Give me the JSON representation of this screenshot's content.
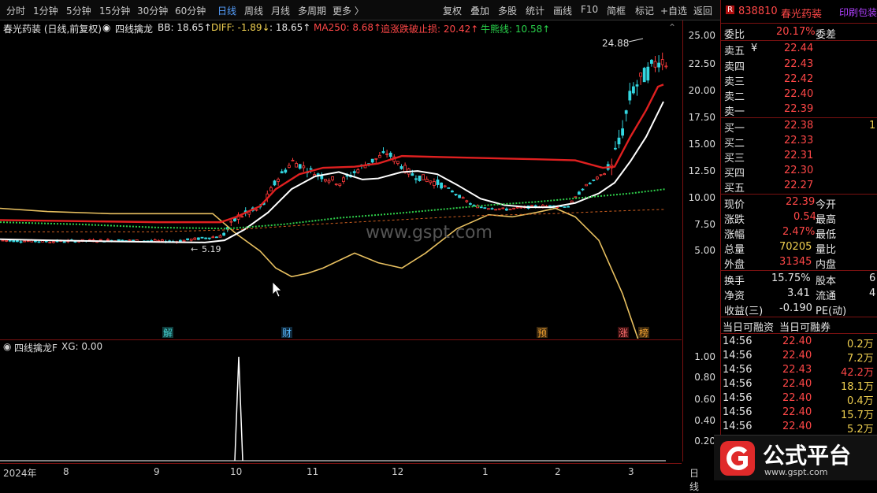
{
  "toolbar": {
    "periods": [
      "分时",
      "1分钟",
      "5分钟",
      "15分钟",
      "30分钟",
      "60分钟",
      "日线",
      "周线",
      "月线",
      "多周期",
      "更多 〉"
    ],
    "active_period": "日线",
    "tools": [
      "复权",
      "叠加",
      "多股",
      "统计",
      "画线",
      "F10",
      "简框",
      "标记",
      "+自选",
      "返回"
    ]
  },
  "info_line": {
    "stock_title": "春光药装 (日线,前复权)",
    "indicator": "四线擒龙",
    "bb": "BB: 18.65↑",
    "diff": "DIFF: -1.89↓",
    "unnamed": ": 18.65↑",
    "ma250": "MA250: 8.68↑",
    "stop": "追涨跌破止损: 20.42↑",
    "bull": "牛熊线: 10.58↑"
  },
  "price_axis": [
    "25.00",
    "22.50",
    "20.00",
    "17.50",
    "15.00",
    "12.50",
    "10.00",
    "7.50",
    "5.00"
  ],
  "sub_axis": [
    "1.00",
    "0.80",
    "0.60",
    "0.40",
    "0.20"
  ],
  "annotations": {
    "high": "24.88",
    "low": "5.19",
    "watermark": "www.gspt.com"
  },
  "markers": [
    "解",
    "财",
    "预",
    "涨",
    "榜"
  ],
  "sub_header": {
    "name": "四线擒龙F",
    "xg": "XG: 0.00"
  },
  "dates": [
    "2024年",
    "8",
    "9",
    "10",
    "11",
    "12",
    "1",
    "2",
    "3",
    "日线"
  ],
  "quote": {
    "code": "838810",
    "name": "春光药装",
    "extra": "印刷包装",
    "weibi_label": "委比",
    "weibi": "20.17%",
    "weicha_label": "委差",
    "weicha": "",
    "asks": [
      {
        "label": "卖五",
        "price": "22.44",
        "vol": ""
      },
      {
        "label": "卖四",
        "price": "22.43",
        "vol": ""
      },
      {
        "label": "卖三",
        "price": "22.42",
        "vol": ""
      },
      {
        "label": "卖二",
        "price": "22.40",
        "vol": ""
      },
      {
        "label": "卖一",
        "price": "22.39",
        "vol": ""
      }
    ],
    "ask_currency": "¥",
    "bids": [
      {
        "label": "买一",
        "price": "22.38",
        "vol": "1"
      },
      {
        "label": "买二",
        "price": "22.33",
        "vol": ""
      },
      {
        "label": "买三",
        "price": "22.31",
        "vol": ""
      },
      {
        "label": "买四",
        "price": "22.30",
        "vol": ""
      },
      {
        "label": "买五",
        "price": "22.27",
        "vol": ""
      }
    ],
    "stats": [
      {
        "l": "现价",
        "v": "22.39",
        "l2": "今开"
      },
      {
        "l": "涨跌",
        "v": "0.54",
        "l2": "最高"
      },
      {
        "l": "涨幅",
        "v": "2.47%",
        "l2": "最低"
      },
      {
        "l": "总量",
        "v": "70205",
        "l2": "量比"
      },
      {
        "l": "外盘",
        "v": "31345",
        "l2": "内盘"
      }
    ],
    "stats2": [
      {
        "l": "换手",
        "v": "15.75%",
        "l2": "股本",
        "v2": "6"
      },
      {
        "l": "净资",
        "v": "3.41",
        "l2": "流通",
        "v2": "4"
      },
      {
        "l": "收益(三)",
        "v": "-0.190",
        "l2": "PE(动)",
        "v2": ""
      }
    ],
    "margin_labels": [
      "当日可融资",
      "当日可融券"
    ],
    "trades": [
      {
        "t": "14:56",
        "p": "22.40",
        "v": "0.2万"
      },
      {
        "t": "14:56",
        "p": "22.40",
        "v": "7.2万"
      },
      {
        "t": "14:56",
        "p": "22.43",
        "v": "42.2万"
      },
      {
        "t": "14:56",
        "p": "22.40",
        "v": "18.1万"
      },
      {
        "t": "14:56",
        "p": "22.40",
        "v": "0.4万"
      },
      {
        "t": "14:56",
        "p": "22.40",
        "v": "15.7万"
      },
      {
        "t": "14:56",
        "p": "22.40",
        "v": "5.2万"
      }
    ]
  },
  "logo": {
    "text": "公式平台",
    "url": "www.gspt.com"
  }
}
